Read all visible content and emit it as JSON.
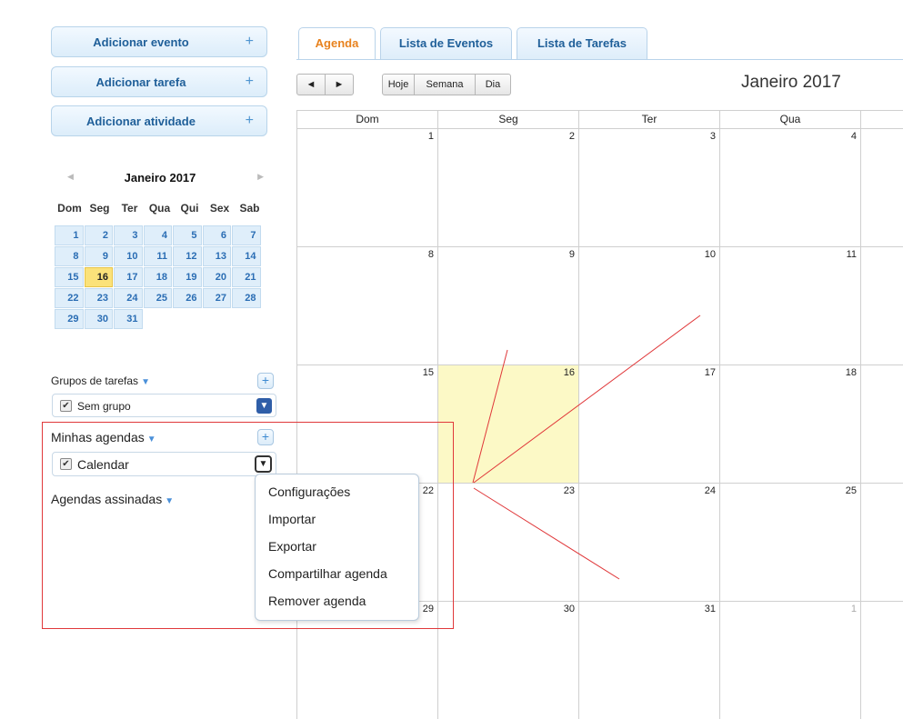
{
  "sidebar": {
    "add_event": "Adicionar evento",
    "add_task": "Adicionar tarefa",
    "add_activity": "Adicionar atividade",
    "plus": "+"
  },
  "mini_calendar": {
    "title": "Janeiro 2017",
    "prev": "◀",
    "next": "▶",
    "weekdays": [
      "Dom",
      "Seg",
      "Ter",
      "Qua",
      "Qui",
      "Sex",
      "Sab"
    ],
    "weeks": [
      [
        "1",
        "2",
        "3",
        "4",
        "5",
        "6",
        "7"
      ],
      [
        "8",
        "9",
        "10",
        "11",
        "12",
        "13",
        "14"
      ],
      [
        "15",
        "16",
        "17",
        "18",
        "19",
        "20",
        "21"
      ],
      [
        "22",
        "23",
        "24",
        "25",
        "26",
        "27",
        "28"
      ],
      [
        "29",
        "30",
        "31",
        "",
        "",
        "",
        ""
      ]
    ],
    "today": "16"
  },
  "task_groups": {
    "title": "Grupos de tarefas",
    "items": [
      {
        "label": "Sem grupo",
        "checked": true
      }
    ]
  },
  "my_calendars": {
    "title": "Minhas agendas",
    "items": [
      {
        "label": "Calendar",
        "checked": true
      }
    ]
  },
  "subscribed_calendars": {
    "title": "Agendas assinadas"
  },
  "context_menu": {
    "items": [
      "Configurações",
      "Importar",
      "Exportar",
      "Compartilhar agenda",
      "Remover agenda"
    ]
  },
  "tabs": [
    "Agenda",
    "Lista de Eventos",
    "Lista de Tarefas"
  ],
  "toolbar": {
    "prev": "◄",
    "next": "►",
    "today": "Hoje",
    "week": "Semana",
    "day": "Dia"
  },
  "main_calendar": {
    "title": "Janeiro 2017",
    "headers": [
      "Dom",
      "Seg",
      "Ter",
      "Qua"
    ],
    "weeks": [
      [
        "1",
        "2",
        "3",
        "4"
      ],
      [
        "8",
        "9",
        "10",
        "11"
      ],
      [
        "15",
        "16",
        "17",
        "18"
      ],
      [
        "22",
        "23",
        "24",
        "25"
      ],
      [
        "29",
        "30",
        "31",
        "1"
      ]
    ],
    "today": "16"
  },
  "colors": {
    "accent": "#1f5f99",
    "active_tab": "#e8821e",
    "today_mini": "#fbe27a",
    "today_main": "#fcf9c6",
    "annotation": "#e0383a"
  }
}
